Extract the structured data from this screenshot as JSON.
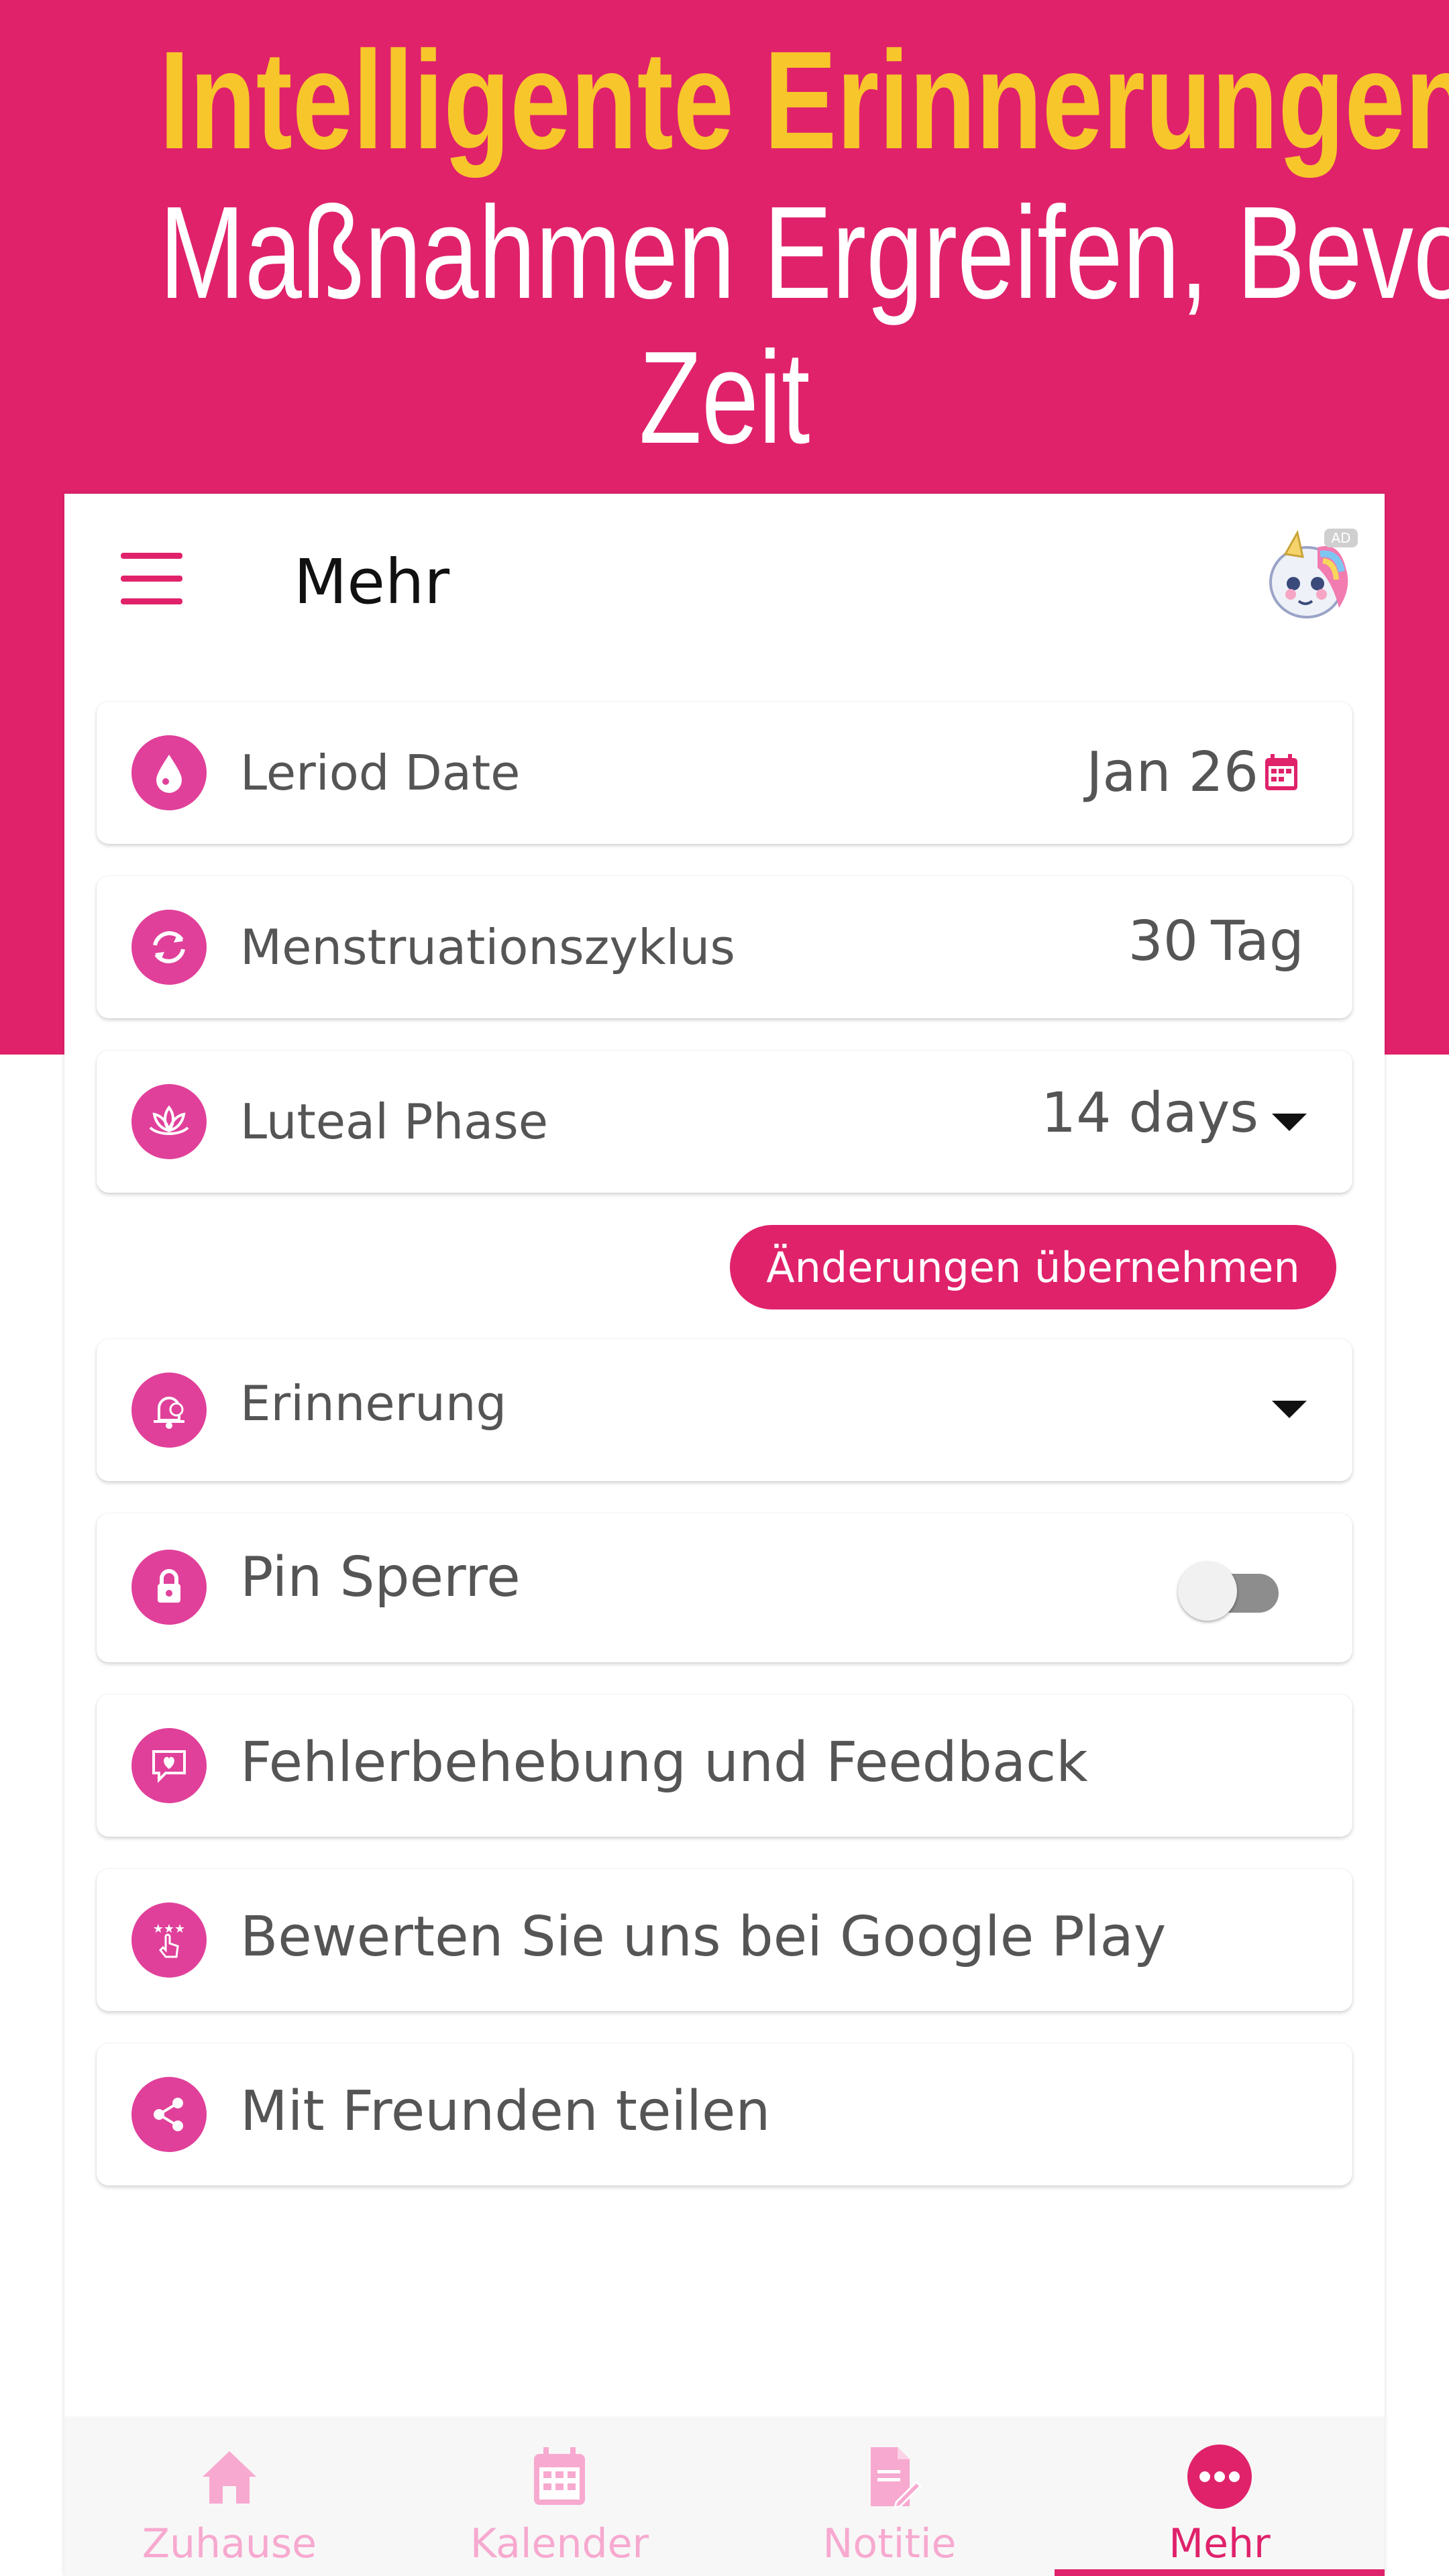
{
  "promo": {
    "headline_1": "Intelligente Erinnerungen",
    "headline_2": "Maßnahmen Ergreifen, Bevor",
    "headline_3": "Zeit"
  },
  "colors": {
    "primary": "#e0226b",
    "icon_bg": "#e0409a",
    "headline_yellow": "#f7c62b",
    "nav_inactive": "#f7a9cf"
  },
  "appbar": {
    "title": "Mehr",
    "ad_badge": "AD",
    "menu_icon": "hamburger-icon"
  },
  "settings": {
    "period_date": {
      "label": "Leriod Date",
      "value": "Jan 26",
      "icon": "drop-icon"
    },
    "cycle": {
      "label": "Menstruationszyklus",
      "value": "30",
      "unit": "Tag",
      "icon": "cycle-icon"
    },
    "luteal": {
      "label": "Luteal Phase",
      "value": "14 days",
      "icon": "lotus-icon"
    },
    "apply_label": "Änderungen übernehmen",
    "reminder": {
      "label": "Erinnerung",
      "icon": "bell-icon"
    },
    "pin_lock": {
      "label": "Pin Sperre",
      "enabled": false,
      "icon": "lock-icon"
    },
    "feedback": {
      "label": "Fehlerbehebung und Feedback",
      "icon": "feedback-icon"
    },
    "rate": {
      "label": "Bewerten Sie uns bei Google Play",
      "icon": "rate-icon"
    },
    "share": {
      "label": "Mit Freunden teilen",
      "icon": "share-icon"
    }
  },
  "nav": {
    "items": [
      {
        "label": "Zuhause",
        "icon": "home-icon",
        "active": false
      },
      {
        "label": "Kalender",
        "icon": "calendar-icon",
        "active": false
      },
      {
        "label": "Notitie",
        "icon": "note-icon",
        "active": false
      },
      {
        "label": "Mehr",
        "icon": "more-icon",
        "active": true
      }
    ]
  }
}
